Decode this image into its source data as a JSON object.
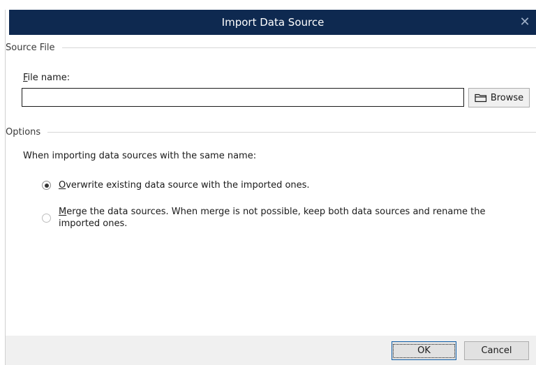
{
  "dialog": {
    "title": "Import Data Source",
    "close_glyph": "✕"
  },
  "source_file": {
    "section_label": "Source File",
    "file_name_label_key": "F",
    "file_name_label_rest": "ile name:",
    "file_name_value": "",
    "browse_label": "Browse",
    "browse_icon": "folder-icon"
  },
  "options": {
    "section_label": "Options",
    "prompt": "When importing data sources with the same name:",
    "choices": [
      {
        "key": "O",
        "rest": "verwrite existing data source with the imported ones.",
        "checked": true
      },
      {
        "key": "M",
        "rest": "erge the data sources. When merge is not possible, keep both data sources and rename the imported ones.",
        "checked": false
      }
    ]
  },
  "footer": {
    "ok_label": "OK",
    "cancel_label": "Cancel"
  },
  "colors": {
    "titlebar": "#0e2950",
    "footer": "#f0f0f0",
    "ok_border": "#0f5ea8"
  }
}
